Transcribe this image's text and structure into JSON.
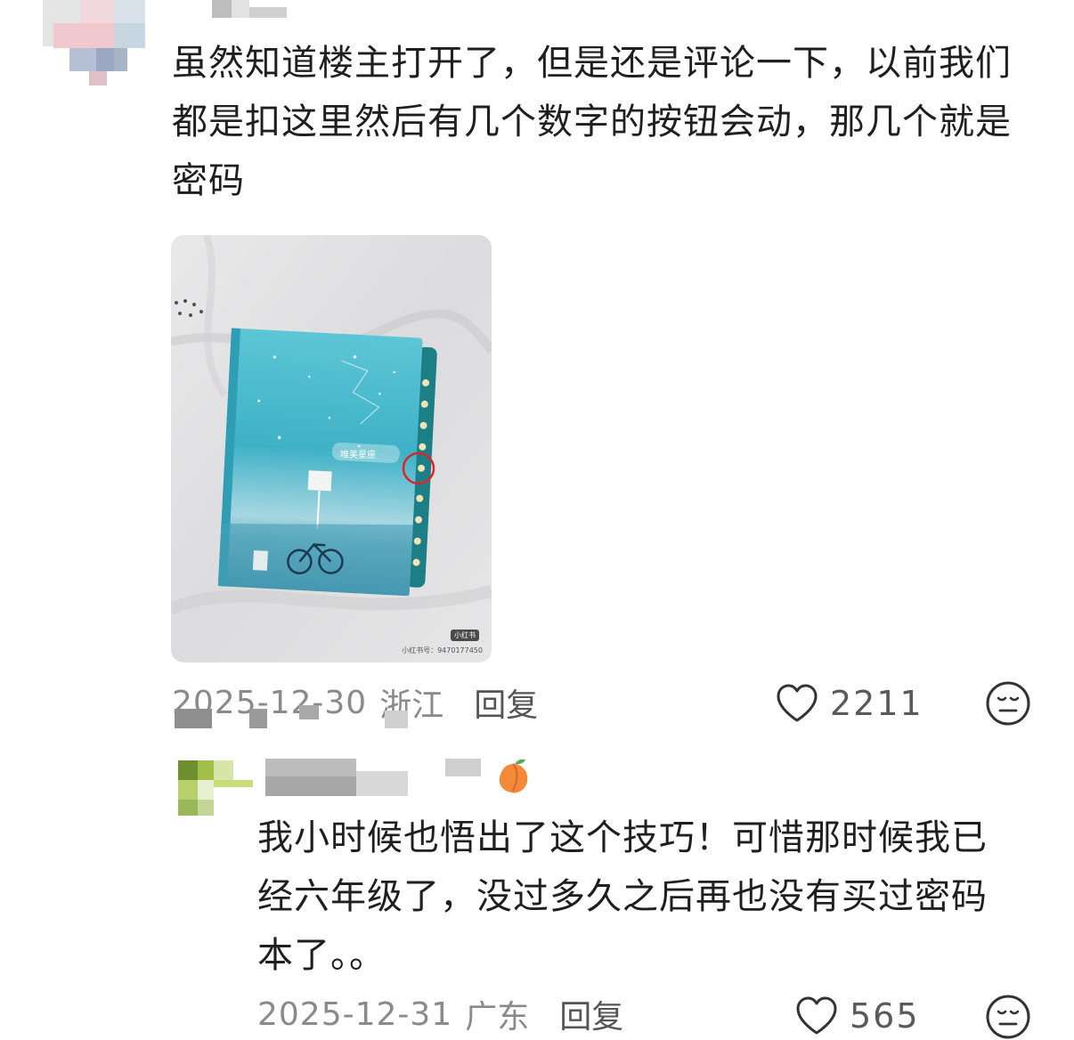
{
  "comments": [
    {
      "text": "虽然知道楼主打开了，但是还是评论一下，以前我们都是扣这里然后有几个数字的按钮会动，那几个就是密码",
      "date": "2025-12-30",
      "location": "浙江",
      "reply_label": "回复",
      "likes": "2211",
      "photo": {
        "book_title": "唯美星座",
        "watermark_badge": "小红书",
        "watermark_id": "小红书号：9470177450"
      }
    },
    {
      "text": "我小时候也悟出了这个技巧！可惜那时候我已经六年级了，没过多久之后再也没有买过密码本了。。",
      "date": "2025-12-31",
      "location": "广东",
      "reply_label": "回复",
      "likes": "565"
    }
  ],
  "icons": {
    "like": "heart-outline-icon",
    "reaction": "meh-face-icon",
    "user_badge": "peach-emoji-icon"
  },
  "colors": {
    "text": "#1f1f1f",
    "meta": "#8a8a8a",
    "book": "#3fb7c9",
    "circle_mark": "#d9262b"
  }
}
